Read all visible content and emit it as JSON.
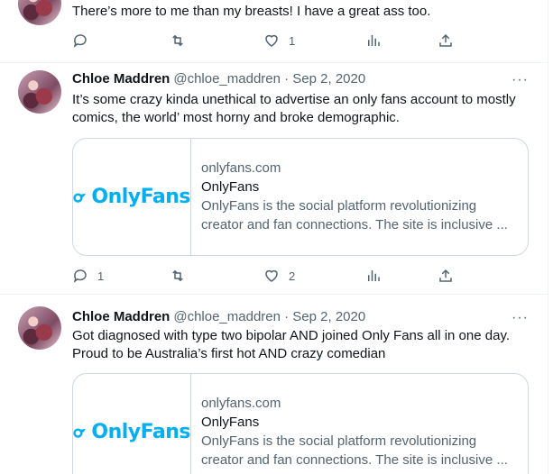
{
  "tweets": [
    {
      "text": "There’s more to me than my breasts! I have a great ass too.",
      "actions": {
        "replies": "",
        "retweets": "",
        "likes": "1"
      }
    },
    {
      "name": "Chloe Maddren",
      "handle": "@chloe_maddren · Sep 2, 2020",
      "more": "···",
      "text": "It’s some crazy kinda unethical to advertise an only fans account to mostly comics, the world’ most horny and broke demographic.",
      "card": {
        "logo": "OnlyFans",
        "domain": "onlyfans.com",
        "title": "OnlyFans",
        "description": "OnlyFans is the social platform revolutionizing creator and fan connections. The site is inclusive ..."
      },
      "actions": {
        "replies": "1",
        "retweets": "",
        "likes": "2"
      }
    },
    {
      "name": "Chloe Maddren",
      "handle": "@chloe_maddren · Sep 2, 2020",
      "more": "···",
      "text": "Got diagnosed with type two bipolar AND joined Only Fans all in one day. Proud to be Australia’s first hot AND crazy comedian",
      "card": {
        "logo": "OnlyFans",
        "domain": "onlyfans.com",
        "title": "OnlyFans",
        "description": "OnlyFans is the social platform revolutionizing creator and fan connections. The site is inclusive ..."
      }
    }
  ],
  "icons": [
    "reply-icon",
    "retweet-icon",
    "like-icon",
    "views-icon",
    "share-icon",
    "more-icon",
    "onlyfans-logo-icon"
  ],
  "colors": {
    "accent": "#00aff0",
    "muted": "#536471",
    "border": "#cfd9de"
  }
}
